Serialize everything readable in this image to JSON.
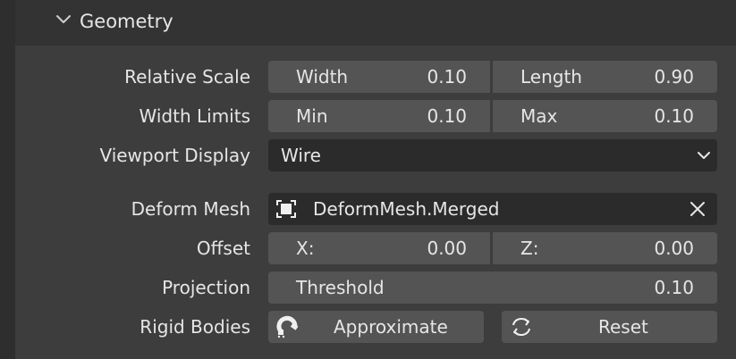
{
  "panel": {
    "title": "Geometry",
    "icons": {
      "collapse": "chevron-down-icon"
    }
  },
  "rows": {
    "relative_scale": {
      "label": "Relative Scale",
      "a_label": "Width",
      "a_value": "0.10",
      "b_label": "Length",
      "b_value": "0.90"
    },
    "width_limits": {
      "label": "Width Limits",
      "a_label": "Min",
      "a_value": "0.10",
      "b_label": "Max",
      "b_value": "0.10"
    },
    "viewport_display": {
      "label": "Viewport Display",
      "value": "Wire"
    },
    "deform_mesh": {
      "label": "Deform Mesh",
      "value": "DeformMesh.Merged"
    },
    "offset": {
      "label": "Offset",
      "a_label": "X:",
      "a_value": "0.00",
      "b_label": "Z:",
      "b_value": "0.00"
    },
    "projection": {
      "label": "Projection",
      "field_label": "Threshold",
      "value": "0.10"
    },
    "rigid_bodies": {
      "label": "Rigid Bodies",
      "approximate_label": "Approximate",
      "reset_label": "Reset"
    }
  },
  "colors": {
    "panel_bg": "#3d3d3d",
    "header_bg": "#333333",
    "field_bg": "#545454",
    "dropdown_bg": "#2b2b2b",
    "text": "#e6e6e6"
  }
}
